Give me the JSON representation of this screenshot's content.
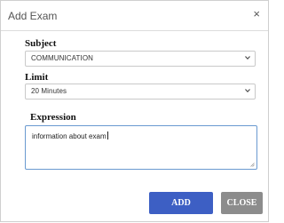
{
  "dialog": {
    "title": "Add Exam",
    "close_icon": "×"
  },
  "subject": {
    "label": "Subject",
    "value": "COMMUNICATION"
  },
  "limit": {
    "label": "Limit",
    "value": "20 Minutes"
  },
  "expression": {
    "label": "Expression",
    "value": "information about exam"
  },
  "buttons": {
    "add_label": "ADD",
    "close_label": "CLOSE"
  },
  "colors": {
    "add_button": "#3d5fc4",
    "close_button": "#8c8c8c",
    "focus_border": "#6a9ad0"
  }
}
